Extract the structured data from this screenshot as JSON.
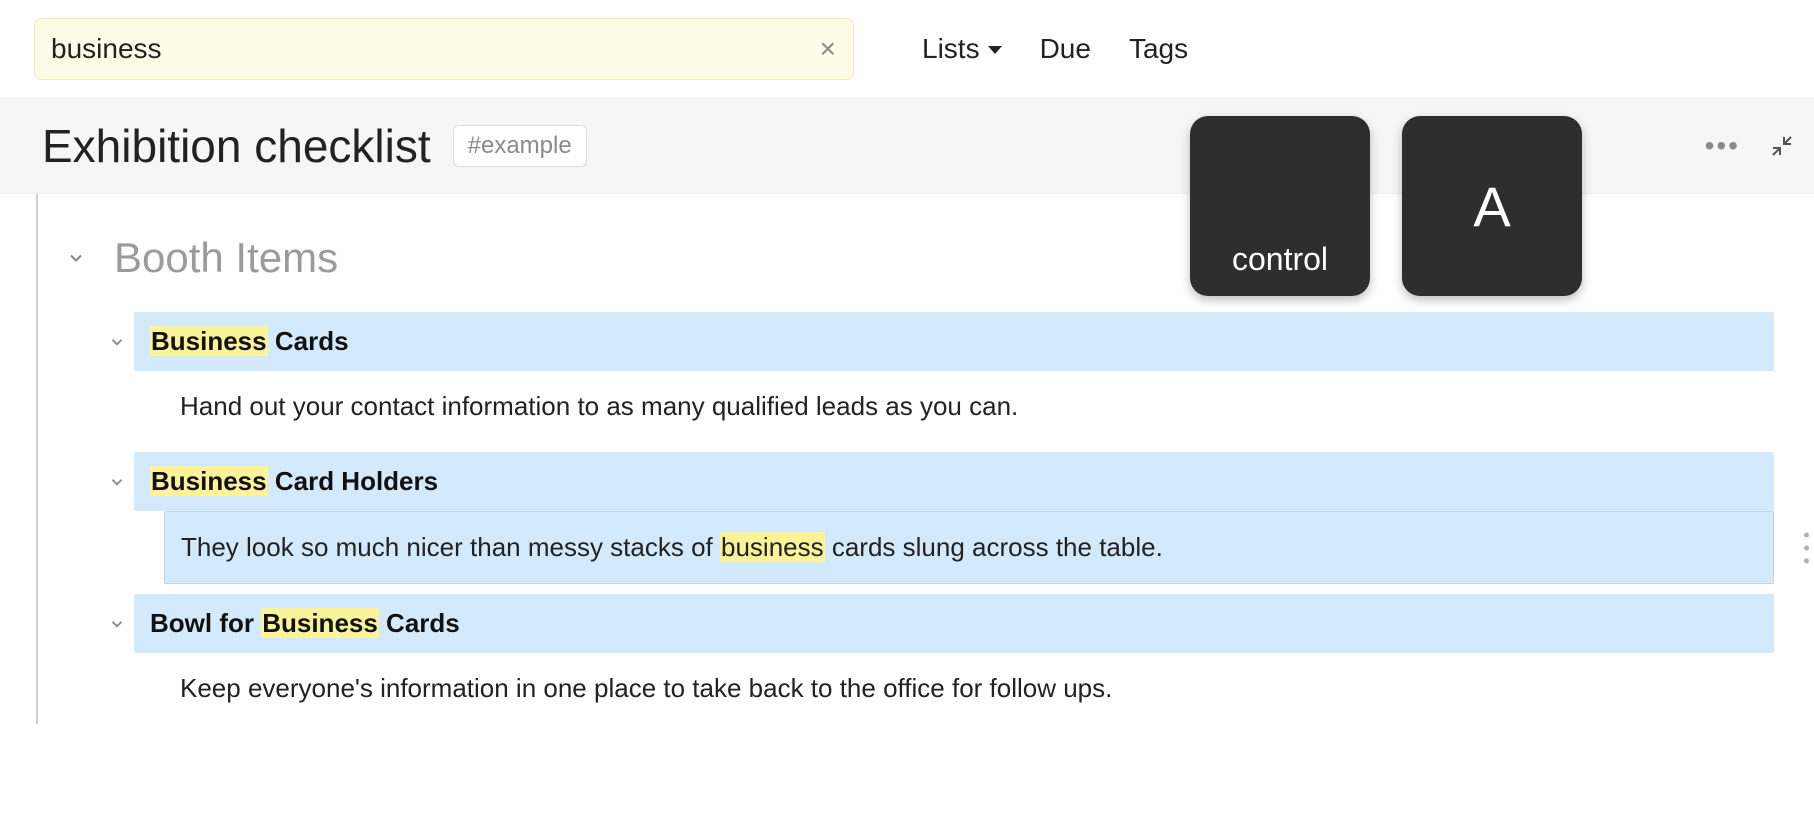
{
  "search": {
    "value": "business"
  },
  "filters": {
    "lists": "Lists",
    "due": "Due",
    "tags": "Tags"
  },
  "header": {
    "title": "Exhibition checklist",
    "tag": "#example"
  },
  "section": {
    "title": "Booth Items",
    "items": [
      {
        "title_pre": "",
        "title_hl": "Business",
        "title_post": " Cards",
        "note_pre": "Hand out your contact information to as many qualified leads as you can.",
        "note_hl": "",
        "note_post": "",
        "note_highlighted": false
      },
      {
        "title_pre": "",
        "title_hl": "Business",
        "title_post": " Card Holders",
        "note_pre": "They look so much nicer than messy stacks of ",
        "note_hl": "business",
        "note_post": " cards slung across the table.",
        "note_highlighted": true
      },
      {
        "title_pre": "Bowl for ",
        "title_hl": "Business",
        "title_post": " Cards",
        "note_pre": "Keep everyone's information in one place to take back to the office for follow ups.",
        "note_hl": "",
        "note_post": "",
        "note_highlighted": false
      }
    ]
  },
  "keys": {
    "control": "control",
    "a": "A"
  }
}
